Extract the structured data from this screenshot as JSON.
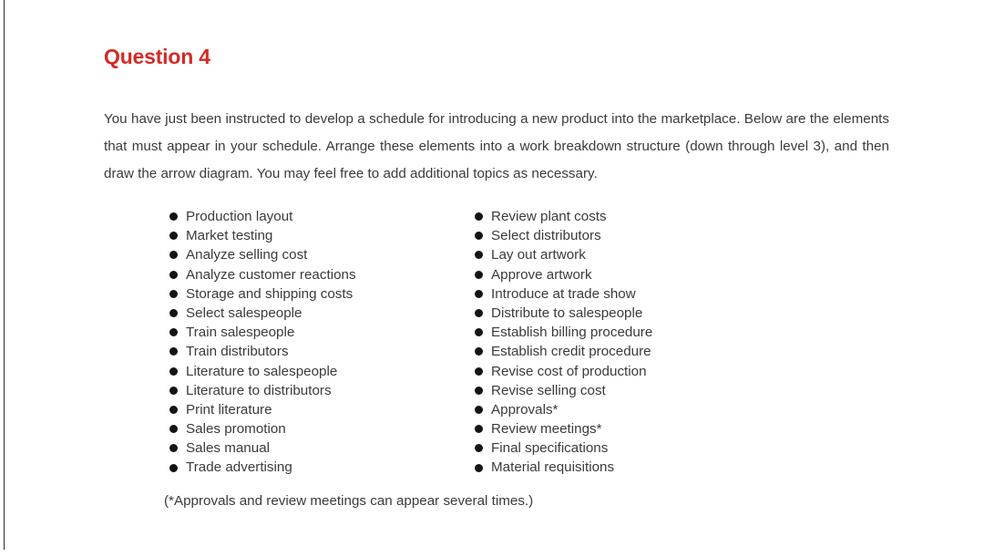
{
  "page": {
    "title": "Question 4",
    "title_color": "#d22b25",
    "body_text": "You have just been instructed to develop a schedule for introducing a new product into the marketplace. Below are the elements that must appear in your schedule. Arrange these elements into a work breakdown structure (down through level 3), and then draw the arrow diagram. You may feel free to add additional topics as necessary.",
    "footnote": "(*Approvals and review meetings can appear several times.)"
  },
  "elements": {
    "left_column": [
      "Production layout",
      "Market testing",
      "Analyze selling cost",
      "Analyze customer reactions",
      "Storage and shipping costs",
      "Select salespeople",
      "Train salespeople",
      "Train distributors",
      "Literature to salespeople",
      "Literature to distributors",
      "Print literature",
      "Sales promotion",
      "Sales manual",
      "Trade advertising"
    ],
    "right_column": [
      "Review plant costs",
      "Select distributors",
      "Lay out artwork",
      "Approve artwork",
      "Introduce at trade show",
      "Distribute to salespeople",
      "Establish billing procedure",
      "Establish credit procedure",
      "Revise cost of production",
      "Revise selling cost",
      "Approvals*",
      "Review meetings*",
      "Final specifications",
      "Material requisitions"
    ]
  }
}
